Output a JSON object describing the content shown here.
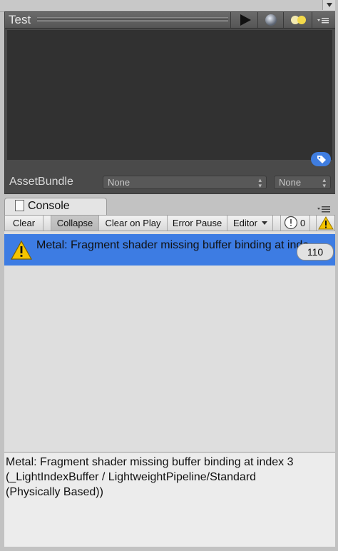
{
  "preview": {
    "title": "Test",
    "assetbundle_label": "AssetBundle",
    "assetbundle_name": "None",
    "assetbundle_variant": "None",
    "icons": [
      "play-icon",
      "sphere-icon",
      "light-icon",
      "panel-menu-icon",
      "tag-icon"
    ]
  },
  "console": {
    "tab_label": "Console",
    "toolbar": {
      "clear": "Clear",
      "collapse": "Collapse",
      "clear_on_play": "Clear on Play",
      "error_pause": "Error Pause",
      "editor": "Editor",
      "info_count": "0"
    },
    "entries": [
      {
        "text": "Metal: Fragment shader missing buffer binding at inde",
        "count": "110",
        "icon": "warning-icon",
        "selected": true
      }
    ],
    "detail": "Metal: Fragment shader missing buffer binding at index 3\n(_LightIndexBuffer / LightweightPipeline/Standard\n(Physically Based))"
  },
  "colors": {
    "selection": "#3d7ce3",
    "warning": "#f5c400",
    "tag_button": "#3f7de0"
  }
}
